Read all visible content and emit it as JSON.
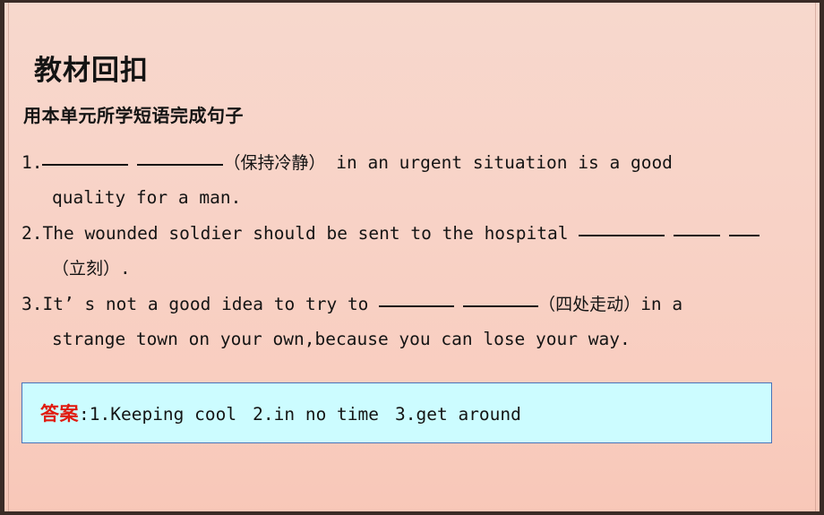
{
  "slide": {
    "title": "教材回扣",
    "subtitle": "用本单元所学短语完成句子",
    "background_color": "#f7d2c6",
    "frame_color": "#3a2b26"
  },
  "questions": [
    {
      "number": "1.",
      "lines": [
        {
          "segments": [
            {
              "type": "blank",
              "width": "long"
            },
            {
              "type": "space"
            },
            {
              "type": "blank",
              "width": "long"
            },
            {
              "type": "cn",
              "text": "（保持冷静）"
            },
            {
              "type": "text",
              "text": " in an urgent situation is a good"
            }
          ]
        },
        {
          "indent": true,
          "segments": [
            {
              "type": "text",
              "text": "quality for a man."
            }
          ]
        }
      ]
    },
    {
      "number": "2.",
      "lines": [
        {
          "segments": [
            {
              "type": "text",
              "text": "The wounded soldier should be sent to the hospital "
            },
            {
              "type": "blank",
              "width": "long"
            },
            {
              "type": "space"
            },
            {
              "type": "blank",
              "width": "short"
            },
            {
              "type": "space"
            },
            {
              "type": "blank",
              "width": "tiny"
            }
          ]
        },
        {
          "indent": true,
          "segments": [
            {
              "type": "cn",
              "text": "（立刻）"
            },
            {
              "type": "text",
              "text": "."
            }
          ]
        }
      ]
    },
    {
      "number": "3.",
      "lines": [
        {
          "segments": [
            {
              "type": "text",
              "text": "It’ s not a good idea to try to "
            },
            {
              "type": "blank",
              "width": "med"
            },
            {
              "type": "space"
            },
            {
              "type": "blank",
              "width": "med"
            },
            {
              "type": "cn",
              "text": "（四处走动）"
            },
            {
              "type": "text",
              "text": "in a"
            }
          ]
        },
        {
          "indent": true,
          "segments": [
            {
              "type": "text",
              "text": "strange town on your own,because you can lose your way."
            }
          ]
        }
      ]
    }
  ],
  "answer_box": {
    "label": "答案",
    "separator": ":",
    "label_color": "#e01b10",
    "fill_color": "#ccfcff",
    "border_color": "#4a72b8",
    "items": [
      "1.Keeping cool",
      "2.in no time",
      "3.get around"
    ]
  }
}
